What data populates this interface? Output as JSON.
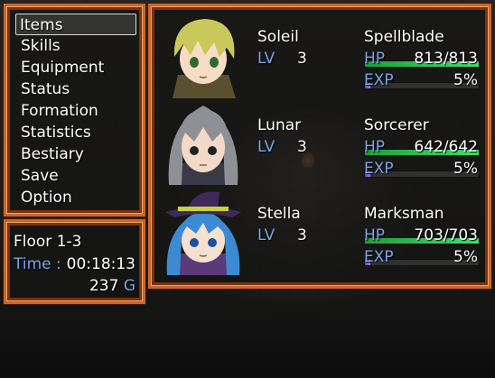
{
  "menu": {
    "items": [
      "Items",
      "Skills",
      "Equipment",
      "Status",
      "Formation",
      "Statistics",
      "Bestiary",
      "Save",
      "Option"
    ],
    "selected_index": 0
  },
  "info": {
    "location": "Floor 1-3",
    "time_label": "Time :",
    "time_value": "00:18:13",
    "gold_value": "237",
    "gold_unit": "G"
  },
  "labels": {
    "lv": "LV",
    "hp": "HP",
    "exp": "EXP"
  },
  "party": [
    {
      "name": "Soleil",
      "level": "3",
      "class": "Spellblade",
      "hp_text": "813/813",
      "hp_ratio": 1.0,
      "exp_text": "5%",
      "exp_ratio": 0.05,
      "hair_color": "#c9c85a"
    },
    {
      "name": "Lunar",
      "level": "3",
      "class": "Sorcerer",
      "hp_text": "642/642",
      "hp_ratio": 1.0,
      "exp_text": "5%",
      "exp_ratio": 0.05,
      "hair_color": "#8e9096"
    },
    {
      "name": "Stella",
      "level": "3",
      "class": "Marksman",
      "hp_text": "703/703",
      "hp_ratio": 1.0,
      "exp_text": "5%",
      "exp_ratio": 0.05,
      "hair_color": "#3c8ad2"
    }
  ],
  "colors": {
    "frame": "#c9672b",
    "accent_text": "#7aa4e6",
    "hp": "#2fcf5a",
    "exp": "#8a5ce8"
  }
}
